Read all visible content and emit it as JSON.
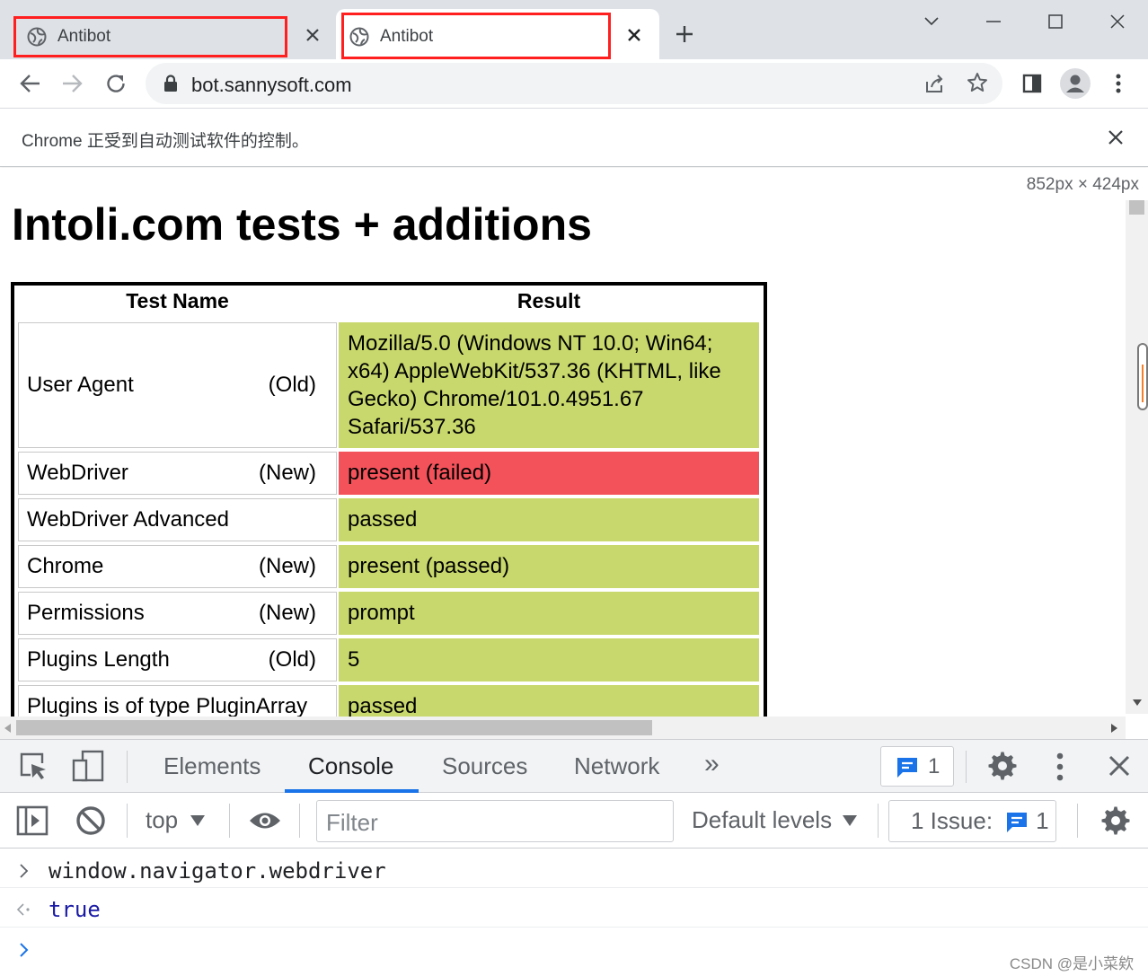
{
  "browser": {
    "tabs": [
      {
        "title": "Antibot"
      },
      {
        "title": "Antibot"
      }
    ],
    "url": "bot.sannysoft.com",
    "infobar_text": "Chrome 正受到自动测试软件的控制。"
  },
  "page": {
    "viewport_size_label": "852px × 424px",
    "heading": "Intoli.com tests + additions",
    "table": {
      "headers": {
        "name": "Test Name",
        "result": "Result"
      },
      "rows": [
        {
          "name": "User Agent",
          "tag": "(Old)",
          "result": "Mozilla/5.0 (Windows NT 10.0; Win64; x64) AppleWebKit/537.36 (KHTML, like Gecko) Chrome/101.0.4951.67 Safari/537.36",
          "status": "passed"
        },
        {
          "name": "WebDriver",
          "tag": "(New)",
          "result": "present (failed)",
          "status": "failed"
        },
        {
          "name": "WebDriver Advanced",
          "tag": "",
          "result": "passed",
          "status": "passed"
        },
        {
          "name": "Chrome",
          "tag": "(New)",
          "result": "present (passed)",
          "status": "passed"
        },
        {
          "name": "Permissions",
          "tag": "(New)",
          "result": "prompt",
          "status": "passed"
        },
        {
          "name": "Plugins Length",
          "tag": "(Old)",
          "result": "5",
          "status": "passed"
        },
        {
          "name": "Plugins is of type PluginArray",
          "tag": "",
          "result": "passed",
          "status": "passed"
        }
      ]
    }
  },
  "devtools": {
    "tabs": [
      "Elements",
      "Console",
      "Sources",
      "Network"
    ],
    "active_tab": "Console",
    "more_tabs_label": "»",
    "messages_badge": "1",
    "context": "top",
    "filter_placeholder": "Filter",
    "levels_label": "Default levels",
    "issues_label": "1 Issue:",
    "issues_count": "1",
    "console": {
      "input": "window.navigator.webdriver",
      "output": "true"
    }
  },
  "watermark": "CSDN @是小菜欸",
  "colors": {
    "pass_green": "#c9d86c",
    "fail_red": "#f4525a",
    "accent_blue": "#1a73e8",
    "highlight_red": "#ff1f1f"
  }
}
